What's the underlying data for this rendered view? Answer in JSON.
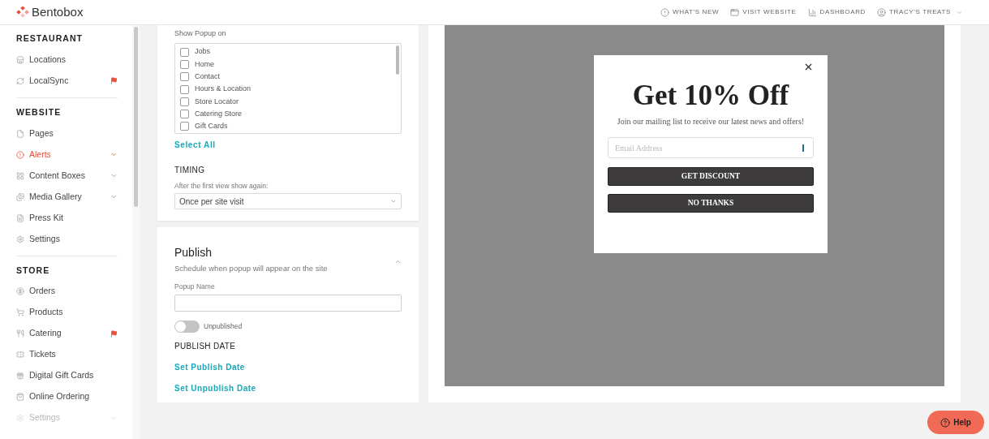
{
  "header": {
    "logo": "Bentobox",
    "links": [
      "WHAT'S NEW",
      "VISIT WEBSITE",
      "DASHBOARD",
      "TRACY'S TREATS"
    ]
  },
  "sidebar": {
    "sections": [
      {
        "title": "RESTAURANT",
        "items": [
          {
            "label": "Locations",
            "selected": false,
            "flagged": false,
            "submenu": false,
            "disabled": false
          },
          {
            "label": "LocalSync",
            "selected": false,
            "flagged": true,
            "submenu": false,
            "disabled": false
          }
        ]
      },
      {
        "title": "WEBSITE",
        "items": [
          {
            "label": "Pages",
            "selected": false,
            "flagged": false,
            "submenu": false,
            "disabled": false
          },
          {
            "label": "Alerts",
            "selected": true,
            "flagged": false,
            "submenu": true,
            "disabled": false
          },
          {
            "label": "Content Boxes",
            "selected": false,
            "flagged": false,
            "submenu": true,
            "disabled": false
          },
          {
            "label": "Media Gallery",
            "selected": false,
            "flagged": false,
            "submenu": true,
            "disabled": false
          },
          {
            "label": "Press Kit",
            "selected": false,
            "flagged": false,
            "submenu": false,
            "disabled": false
          },
          {
            "label": "Settings",
            "selected": false,
            "flagged": false,
            "submenu": false,
            "disabled": false
          }
        ]
      },
      {
        "title": "STORE",
        "items": [
          {
            "label": "Orders",
            "selected": false,
            "flagged": false,
            "submenu": false,
            "disabled": false
          },
          {
            "label": "Products",
            "selected": false,
            "flagged": false,
            "submenu": false,
            "disabled": false
          },
          {
            "label": "Catering",
            "selected": false,
            "flagged": true,
            "submenu": false,
            "disabled": false
          },
          {
            "label": "Tickets",
            "selected": false,
            "flagged": false,
            "submenu": false,
            "disabled": false
          },
          {
            "label": "Digital Gift Cards",
            "selected": false,
            "flagged": false,
            "submenu": false,
            "disabled": false
          },
          {
            "label": "Online Ordering",
            "selected": false,
            "flagged": false,
            "submenu": false,
            "disabled": false
          },
          {
            "label": "Settings",
            "selected": false,
            "flagged": false,
            "submenu": true,
            "disabled": true
          }
        ]
      }
    ]
  },
  "display": {
    "label": "Show Popup on",
    "pages": [
      {
        "label": "Jobs",
        "checked": false
      },
      {
        "label": "Home",
        "checked": false
      },
      {
        "label": "Contact",
        "checked": false
      },
      {
        "label": "Hours & Location",
        "checked": false
      },
      {
        "label": "Store Locator",
        "checked": false
      },
      {
        "label": "Catering Store",
        "checked": false
      },
      {
        "label": "Gift Cards",
        "checked": false
      }
    ],
    "select_all": "Select All",
    "timing_title": "TIMING",
    "timing_label": "After the first view show again:",
    "timing_value": "Once per site visit"
  },
  "publish": {
    "title": "Publish",
    "subtitle": "Schedule when popup will appear on the site",
    "expanded": true,
    "name_label": "Popup Name",
    "toggle": {
      "label": "Unpublished",
      "on": false
    },
    "date_title": "PUBLISH DATE",
    "links": [
      "Set Publish Date",
      "Set Unpublish Date"
    ]
  },
  "preview": {
    "title": "Get 10% Off",
    "text": "Join our mailing list to receive our latest news and offers!",
    "email_placeholder": "Email Address",
    "buttons": [
      "GET DISCOUNT",
      "NO THANKS"
    ]
  },
  "help": "Help"
}
